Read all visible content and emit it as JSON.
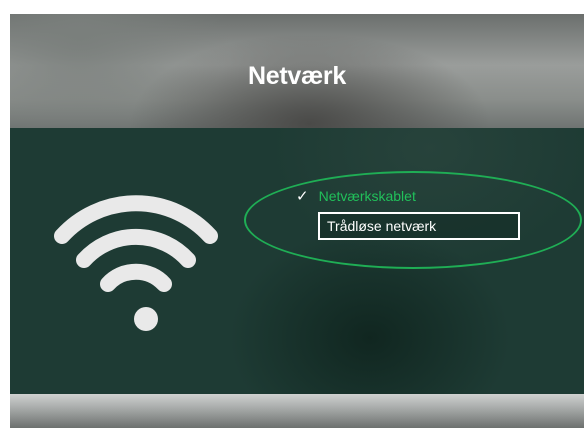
{
  "header": {
    "title": "Netværk"
  },
  "menu": {
    "items": [
      {
        "label": "Netværkskablet",
        "checked": true,
        "check_glyph": "✓"
      },
      {
        "label": "Trådløse netværk",
        "focused": true
      }
    ]
  },
  "icons": {
    "network": "wifi-icon"
  },
  "colors": {
    "accent": "#21c05a",
    "panel_background": "#1e3b34",
    "text": "#ffffff"
  }
}
